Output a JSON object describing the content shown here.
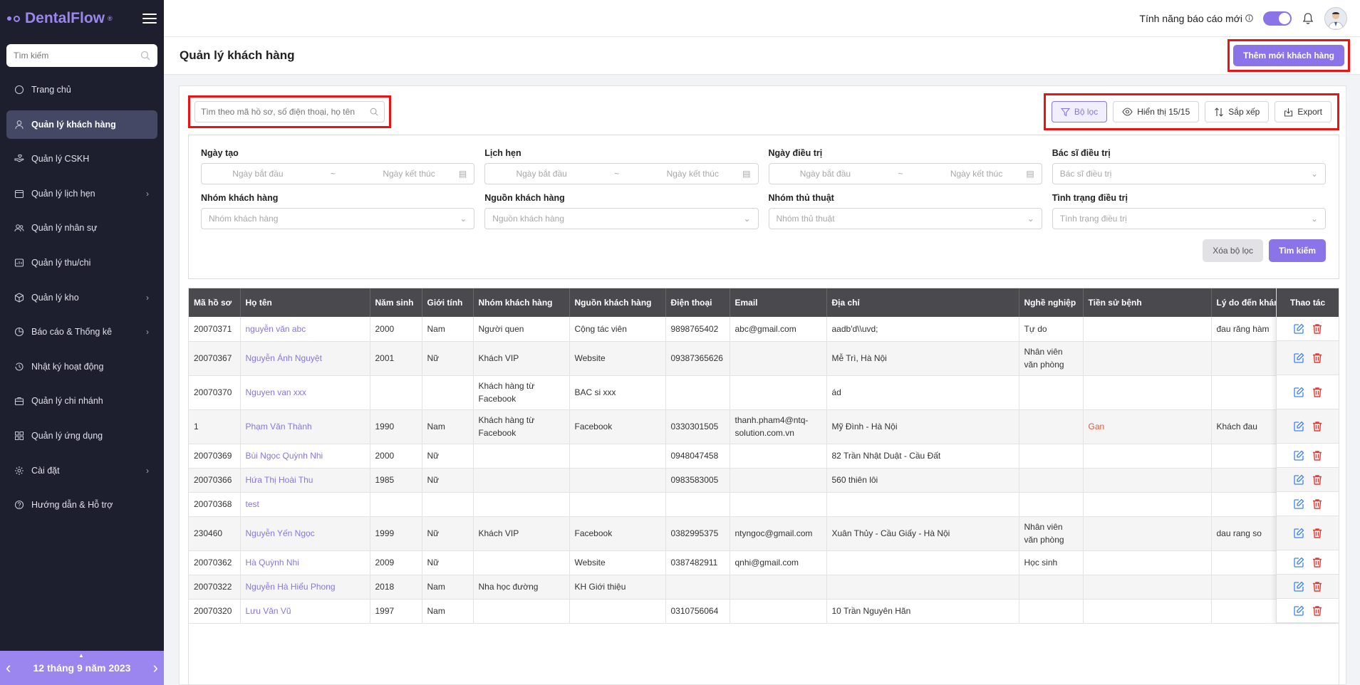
{
  "app": {
    "name": "DentalFlow",
    "trademark": "®"
  },
  "sidebar": {
    "search_placeholder": "Tìm kiếm",
    "items": [
      {
        "label": "Trang chủ",
        "icon": "home-icon",
        "chevron": false,
        "active": false
      },
      {
        "label": "Quản lý khách hàng",
        "icon": "user-icon",
        "chevron": false,
        "active": true
      },
      {
        "label": "Quản lý CSKH",
        "icon": "hand-heart-icon",
        "chevron": false,
        "active": false
      },
      {
        "label": "Quản lý lịch hẹn",
        "icon": "calendar-icon",
        "chevron": true,
        "active": false
      },
      {
        "label": "Quản lý nhân sự",
        "icon": "users-icon",
        "chevron": false,
        "active": false
      },
      {
        "label": "Quản lý thu/chi",
        "icon": "wallet-icon",
        "chevron": false,
        "active": false
      },
      {
        "label": "Quản lý kho",
        "icon": "box-icon",
        "chevron": true,
        "active": false
      },
      {
        "label": "Báo cáo & Thống kê",
        "icon": "chart-icon",
        "chevron": true,
        "active": false
      },
      {
        "label": "Nhật ký hoạt động",
        "icon": "history-icon",
        "chevron": false,
        "active": false
      },
      {
        "label": "Quản lý chi nhánh",
        "icon": "store-icon",
        "chevron": false,
        "active": false
      },
      {
        "label": "Quản lý ứng dụng",
        "icon": "apps-icon",
        "chevron": false,
        "active": false
      },
      {
        "label": "Cài đặt",
        "icon": "gear-icon",
        "chevron": true,
        "active": false
      },
      {
        "label": "Hướng dẫn & Hỗ trợ",
        "icon": "help-icon",
        "chevron": false,
        "active": false
      }
    ],
    "date": "12 tháng 9 năm 2023"
  },
  "topbar": {
    "feature_label": "Tính năng báo cáo mới",
    "toggle_on": true
  },
  "page": {
    "title": "Quản lý khách hàng",
    "add_button": "Thêm mới khách hàng"
  },
  "toolbar": {
    "search_placeholder": "Tìm theo mã hồ sơ, số điện thoại, họ tên",
    "filter": "Bộ lọc",
    "display": "Hiển thị 15/15",
    "sort": "Sắp xếp",
    "export": "Export"
  },
  "filters": {
    "created": {
      "label": "Ngày tạo",
      "start": "Ngày bắt đầu",
      "end": "Ngày kết thúc"
    },
    "appointment": {
      "label": "Lịch hẹn",
      "start": "Ngày bắt đầu",
      "end": "Ngày kết thúc"
    },
    "treatment_date": {
      "label": "Ngày điều trị",
      "start": "Ngày bắt đầu",
      "end": "Ngày kết thúc"
    },
    "doctor": {
      "label": "Bác sĩ điều trị",
      "placeholder": "Bác sĩ điều trị"
    },
    "group": {
      "label": "Nhóm khách hàng",
      "placeholder": "Nhóm khách hàng"
    },
    "source": {
      "label": "Nguồn khách hàng",
      "placeholder": "Nguồn khách hàng"
    },
    "procedure": {
      "label": "Nhóm thủ thuật",
      "placeholder": "Nhóm thủ thuật"
    },
    "status": {
      "label": "Tình trạng điều trị",
      "placeholder": "Tình trạng điều trị"
    },
    "clear": "Xóa bộ lọc",
    "search": "Tìm kiếm"
  },
  "table": {
    "columns": [
      "Mã hồ sơ",
      "Họ tên",
      "Năm sinh",
      "Giới tính",
      "Nhóm khách hàng",
      "Nguồn khách hàng",
      "Điện thoại",
      "Email",
      "Địa chỉ",
      "Nghề nghiệp",
      "Tiền sử bệnh",
      "Lý do đến khám"
    ],
    "action_header": "Thao tác",
    "rows": [
      [
        "20070371",
        "nguyễn văn abc",
        "2000",
        "Nam",
        "Người quen",
        "Cộng tác viên",
        "9898765402",
        "abc@gmail.com",
        "aadb'd\\\\uvd;",
        "Tự do",
        "",
        "đau răng hàm"
      ],
      [
        "20070367",
        "Nguyễn Ánh Nguyệt",
        "2001",
        "Nữ",
        "Khách VIP",
        "Website",
        "09387365626",
        "",
        "Mễ Trì, Hà Nội",
        "Nhân viên văn phòng",
        "",
        ""
      ],
      [
        "20070370",
        "Nguyen van xxx",
        "",
        "",
        "Khách hàng từ Facebook",
        "BAC si xxx",
        "",
        "",
        "ád",
        "",
        "",
        ""
      ],
      [
        "1",
        "Phạm Văn Thành",
        "1990",
        "Nam",
        "Khách hàng từ Facebook",
        "Facebook",
        "0330301505",
        "thanh.pham4@ntq-solution.com.vn",
        "Mỹ Đình - Hà Nội",
        "",
        "Gan",
        "Khách đau"
      ],
      [
        "20070369",
        "Bùi Ngọc Quỳnh Nhi",
        "2000",
        "Nữ",
        "",
        "",
        "0948047458",
        "",
        "82 Trần Nhật Duật - Cầu Đất",
        "",
        "",
        ""
      ],
      [
        "20070366",
        "Hứa Thị Hoài Thu",
        "1985",
        "Nữ",
        "",
        "",
        "0983583005",
        "",
        "560 thiên lôi",
        "",
        "",
        ""
      ],
      [
        "20070368",
        "test",
        "",
        "",
        "",
        "",
        "",
        "",
        "",
        "",
        "",
        ""
      ],
      [
        "230460",
        "Nguyễn Yến Ngọc",
        "1999",
        "Nữ",
        "Khách VIP",
        "Facebook",
        "0382995375",
        "ntyngoc@gmail.com",
        "Xuân Thủy - Cầu Giấy - Hà Nội",
        "Nhân viên văn phòng",
        "",
        "dau rang so"
      ],
      [
        "20070362",
        "Hà Quỳnh Nhi",
        "2009",
        "Nữ",
        "",
        "Website",
        "0387482911",
        "qnhi@gmail.com",
        "",
        "Học sinh",
        "",
        ""
      ],
      [
        "20070322",
        "Nguyễn Hà Hiểu Phong",
        "2018",
        "Nam",
        "Nha học đường",
        "KH Giới thiệu",
        "",
        "",
        "",
        "",
        "",
        ""
      ],
      [
        "20070320",
        "Lưu Văn Vũ",
        "1997",
        "Nam",
        "",
        "",
        "0310756064",
        "",
        "10 Trần Nguyên Hãn",
        "",
        "",
        ""
      ]
    ]
  },
  "colors": {
    "accent": "#8a74e8",
    "sidebar_bg": "#1e1f2e",
    "header_bg": "#4a4a4e",
    "delete": "#e53935",
    "edit": "#3b82f6",
    "highlight": "#e11111"
  }
}
